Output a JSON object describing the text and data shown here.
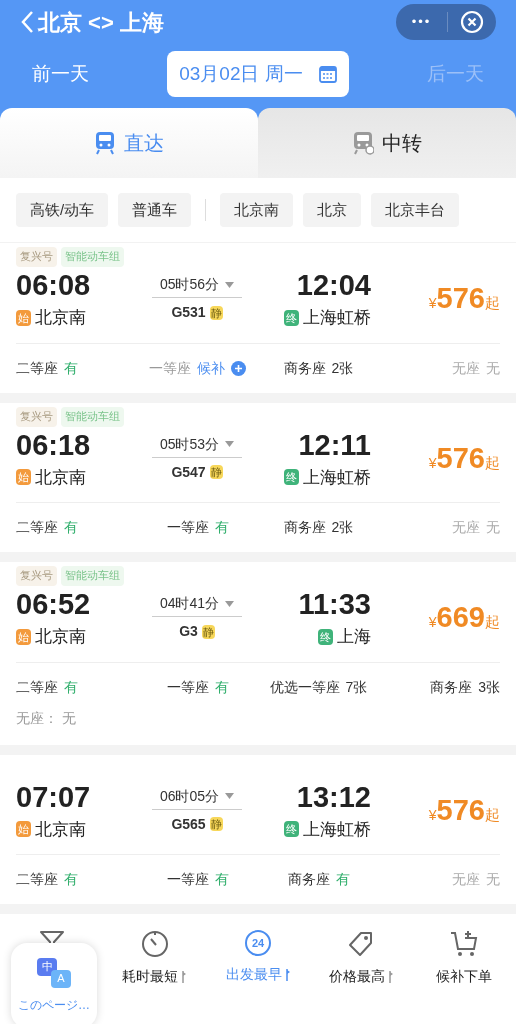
{
  "header": {
    "title": "北京 <> 上海",
    "more": "•••",
    "prev_day": "前一天",
    "date": "03月02日 周一",
    "next_day": "后一天",
    "next_disabled": true
  },
  "tabs": [
    {
      "label": "直达",
      "selected": true
    },
    {
      "label": "中转",
      "selected": false
    }
  ],
  "train_type_chips": [
    "高铁/动车",
    "普通车"
  ],
  "station_chips": [
    "北京南",
    "北京",
    "北京丰台"
  ],
  "trains": [
    {
      "tags": [
        "复兴号",
        "智能动车组"
      ],
      "depart": "06:08",
      "from": "北京南",
      "from_mark": "始",
      "duration": "05时56分",
      "number": "G531",
      "quiet": "静",
      "arrive": "12:04",
      "to": "上海虹桥",
      "to_mark": "终",
      "currency": "¥",
      "price": "576",
      "price_suffix": "起",
      "seats": [
        {
          "label": "二等座",
          "status": "有",
          "kind": "available"
        },
        {
          "label": "一等座",
          "status": "候补",
          "kind": "waitlist"
        },
        {
          "label": "商务座",
          "status": "2张",
          "kind": "count"
        },
        {
          "label": "无座",
          "status": "无",
          "kind": "none"
        }
      ]
    },
    {
      "tags": [
        "复兴号",
        "智能动车组"
      ],
      "depart": "06:18",
      "from": "北京南",
      "from_mark": "始",
      "duration": "05时53分",
      "number": "G547",
      "quiet": "静",
      "arrive": "12:11",
      "to": "上海虹桥",
      "to_mark": "终",
      "currency": "¥",
      "price": "576",
      "price_suffix": "起",
      "seats": [
        {
          "label": "二等座",
          "status": "有",
          "kind": "available"
        },
        {
          "label": "一等座",
          "status": "有",
          "kind": "available"
        },
        {
          "label": "商务座",
          "status": "2张",
          "kind": "count"
        },
        {
          "label": "无座",
          "status": "无",
          "kind": "none"
        }
      ]
    },
    {
      "tags": [
        "复兴号",
        "智能动车组"
      ],
      "depart": "06:52",
      "from": "北京南",
      "from_mark": "始",
      "duration": "04时41分",
      "number": "G3",
      "quiet": "静",
      "arrive": "11:33",
      "to": "上海",
      "to_mark": "终",
      "currency": "¥",
      "price": "669",
      "price_suffix": "起",
      "seats": [
        {
          "label": "二等座",
          "status": "有",
          "kind": "available"
        },
        {
          "label": "一等座",
          "status": "有",
          "kind": "available"
        },
        {
          "label": "优选一等座",
          "status": "7张",
          "kind": "count"
        },
        {
          "label": "商务座",
          "status": "3张",
          "kind": "count"
        }
      ],
      "extra": "无座： 无"
    },
    {
      "depart": "07:07",
      "from": "北京南",
      "from_mark": "始",
      "duration": "06时05分",
      "number": "G565",
      "quiet": "静",
      "arrive": "13:12",
      "to": "上海虹桥",
      "to_mark": "终",
      "currency": "¥",
      "price": "576",
      "price_suffix": "起",
      "seats": [
        {
          "label": "二等座",
          "status": "有",
          "kind": "available"
        },
        {
          "label": "一等座",
          "status": "有",
          "kind": "available"
        },
        {
          "label": "商务座",
          "status": "有",
          "kind": "available"
        },
        {
          "label": "无座",
          "status": "无",
          "kind": "none"
        }
      ]
    }
  ],
  "sort_bar": [
    {
      "kind": "filter",
      "selected": false
    },
    {
      "kind": "duration",
      "label": "耗时最短",
      "sortable": true,
      "selected": false
    },
    {
      "kind": "departure",
      "label": "出发最早",
      "badge": "24",
      "sortable": true,
      "selected": true
    },
    {
      "kind": "price",
      "label": "价格最高",
      "sortable": true,
      "selected": false
    },
    {
      "kind": "waitlist",
      "label": "候补下单",
      "sortable": false,
      "selected": false
    }
  ],
  "translate_popup": {
    "label": "このページ…",
    "icon_zh": "中",
    "icon_en": "A"
  }
}
